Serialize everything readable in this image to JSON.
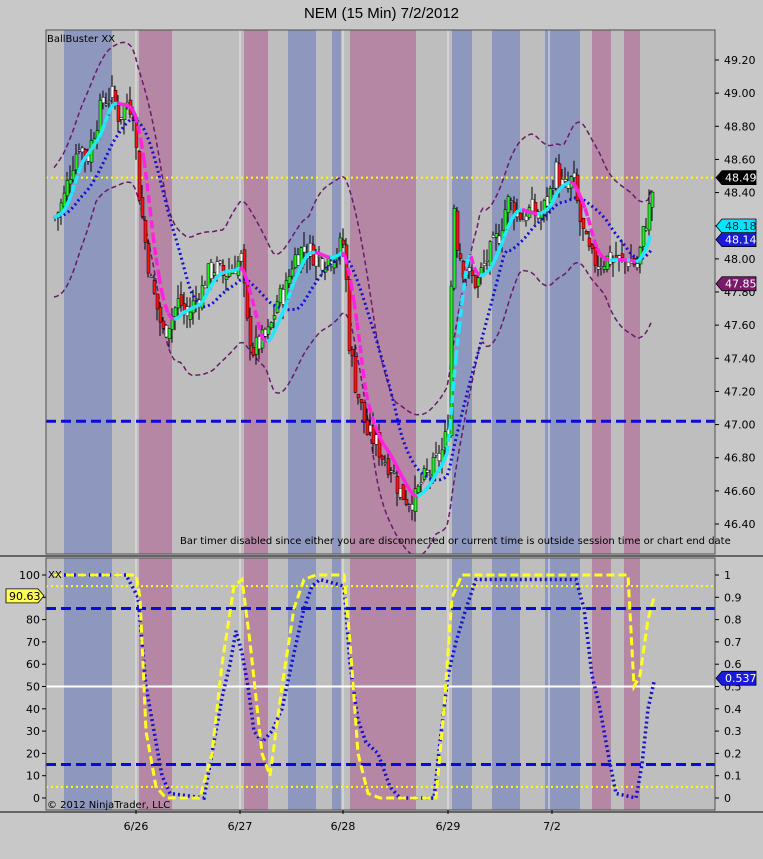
{
  "window": {
    "title": "NEM (15 Min)  7/2/2012"
  },
  "chart_data": [
    {
      "type": "candlestick",
      "indicator_label": "BallBuster XX",
      "ylim": [
        46.25,
        49.32
      ],
      "yticks": [
        "49.20",
        "49.00",
        "48.80",
        "48.60",
        "48.40",
        "48.20",
        "48.00",
        "47.80",
        "47.60",
        "47.40",
        "47.20",
        "47.00",
        "46.80",
        "46.60",
        "46.40"
      ],
      "ytick_values": [
        49.2,
        49.0,
        48.8,
        48.6,
        48.4,
        48.2,
        48.0,
        47.8,
        47.6,
        47.4,
        47.2,
        47.0,
        46.8,
        46.6,
        46.4
      ],
      "price_badges": [
        {
          "label": "48.49",
          "value": 48.49,
          "bg": "#000000",
          "fg": "#ffffff"
        },
        {
          "label": "48.18",
          "value": 48.18,
          "bg": "#00e5ff",
          "fg": "#003040"
        },
        {
          "label": "48.14",
          "value": 48.14,
          "bg": "#1a1adc",
          "fg": "#ffffff"
        },
        {
          "label": "47.85",
          "value": 47.85,
          "bg": "#7a1a6a",
          "fg": "#ffffff"
        }
      ],
      "horizontal_lines": [
        {
          "value": 48.49,
          "color": "#ffff00",
          "style": "dotted"
        },
        {
          "value": 47.02,
          "color": "#0a0adc",
          "style": "dashed"
        }
      ],
      "message": "Bar timer disabled since either you are disconnected or current time is outside session time or chart end date"
    },
    {
      "type": "line",
      "indicator_label": "XX",
      "left_axis": [
        "100",
        "90",
        "80",
        "70",
        "60",
        "50",
        "40",
        "30",
        "20",
        "10",
        "0"
      ],
      "right_axis": [
        "1",
        "0.9",
        "0.8",
        "0.7",
        "0.6",
        "0.5",
        "0.4",
        "0.3",
        "0.2",
        "0.1",
        "0"
      ],
      "ylim": [
        0,
        1
      ],
      "value_badges": [
        {
          "label": "90.63",
          "value": 0.9063,
          "side": "left",
          "bg": "#ffff55",
          "fg": "#000000"
        },
        {
          "label": "0.537",
          "value": 0.537,
          "side": "right",
          "bg": "#1a1adc",
          "fg": "#ffffff"
        }
      ],
      "horizontal_lines": [
        {
          "value": 0.95,
          "color": "#ffff00",
          "style": "dotted"
        },
        {
          "value": 0.85,
          "color": "#0a0adc",
          "style": "dashed"
        },
        {
          "value": 0.5,
          "color": "#ffffff",
          "style": "solid"
        },
        {
          "value": 0.15,
          "color": "#0a0adc",
          "style": "dashed"
        },
        {
          "value": 0.05,
          "color": "#ffff00",
          "style": "dotted"
        }
      ],
      "copyright": "© 2012 NinjaTrader, LLC"
    }
  ],
  "x_axis": {
    "labels": [
      "6/26",
      "6/27",
      "6/28",
      "6/29",
      "7/2"
    ]
  }
}
